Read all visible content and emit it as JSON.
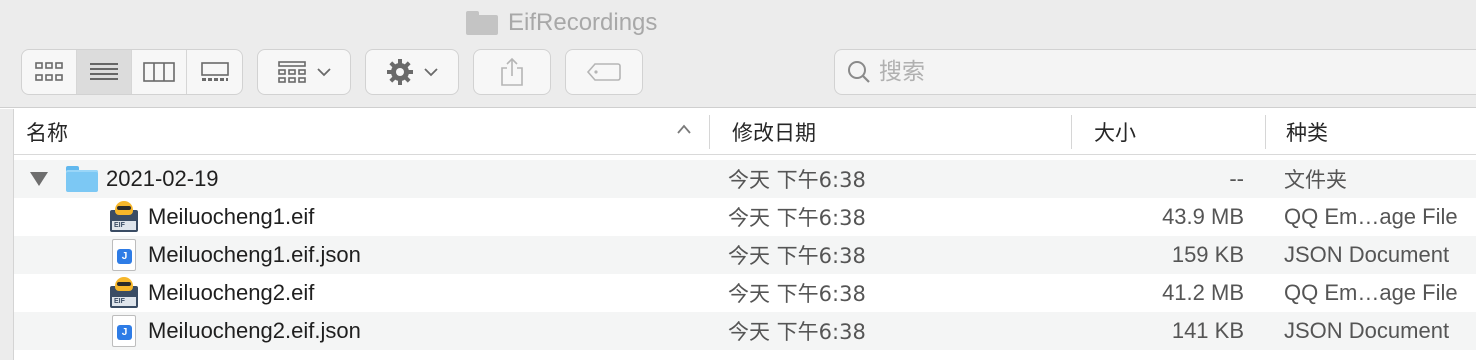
{
  "window": {
    "title": "EifRecordings"
  },
  "toolbar": {
    "view_modes": [
      {
        "name": "icon-view",
        "active": false
      },
      {
        "name": "list-view",
        "active": true
      },
      {
        "name": "column-view",
        "active": false
      },
      {
        "name": "gallery-view",
        "active": false
      }
    ],
    "group_icon": "group-grid-icon",
    "action_icon": "gear-icon",
    "share_icon": "share-icon",
    "tag_icon": "tag-icon"
  },
  "search": {
    "placeholder": "搜索",
    "value": ""
  },
  "columns": {
    "name": "名称",
    "date": "修改日期",
    "size": "大小",
    "kind": "种类",
    "sort_direction": "ascending"
  },
  "rows": [
    {
      "name": "2021-02-19",
      "date": "今天 下午6:38",
      "size": "--",
      "kind": "文件夹",
      "type": "folder",
      "expanded": true
    },
    {
      "name": "Meiluocheng1.eif",
      "date": "今天 下午6:38",
      "size": "43.9 MB",
      "kind": "QQ Em…age File",
      "type": "eif",
      "eif_label": "EIF"
    },
    {
      "name": "Meiluocheng1.eif.json",
      "date": "今天 下午6:38",
      "size": "159 KB",
      "kind": "JSON Document",
      "type": "json",
      "json_label": "J"
    },
    {
      "name": "Meiluocheng2.eif",
      "date": "今天 下午6:38",
      "size": "41.2 MB",
      "kind": "QQ Em…age File",
      "type": "eif",
      "eif_label": "EIF"
    },
    {
      "name": "Meiluocheng2.eif.json",
      "date": "今天 下午6:38",
      "size": "141 KB",
      "kind": "JSON Document",
      "type": "json",
      "json_label": "J"
    }
  ],
  "colors": {
    "folder": "#7cc8f4",
    "selected_view_bg": "#dcdcdc",
    "toolbar_bg": "#ececec",
    "alt_row": "#f4f5f5"
  }
}
